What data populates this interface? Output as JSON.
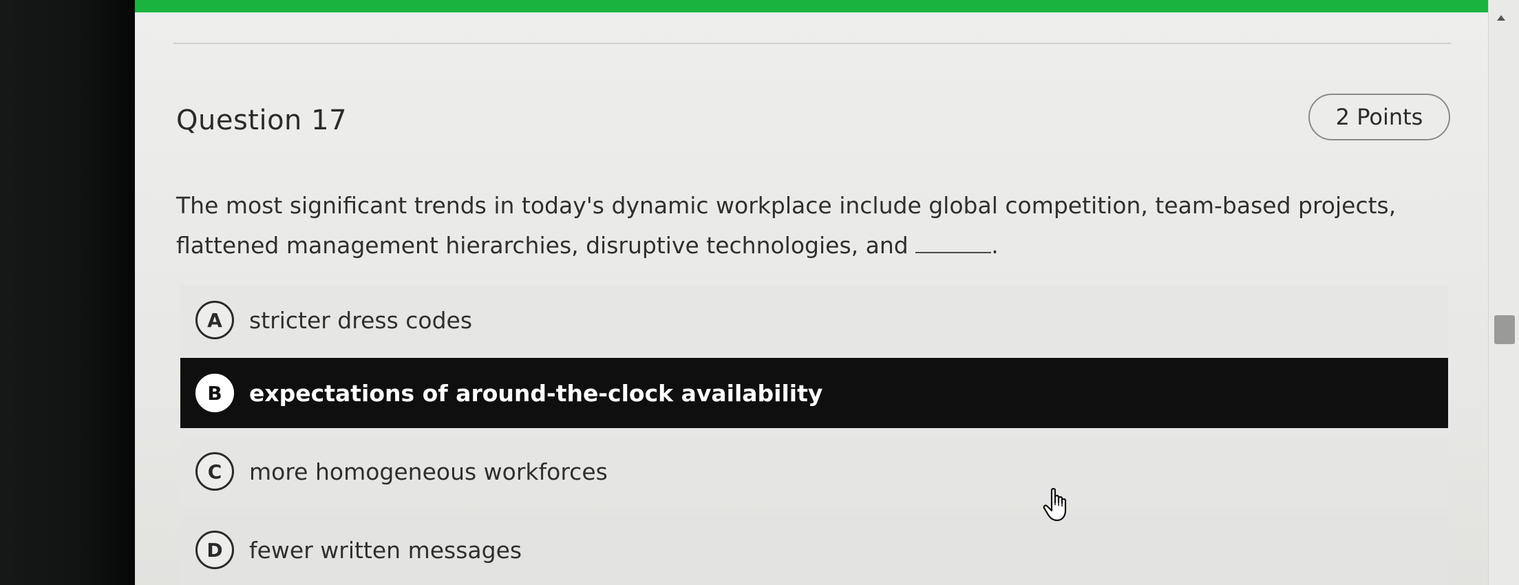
{
  "question": {
    "title": "Question 17",
    "points": "2 Points",
    "text_before": "The most significant trends in today's dynamic workplace include global competition, team-based projects, flattened management hierarchies, disruptive technologies, and",
    "text_after": "."
  },
  "options": [
    {
      "letter": "A",
      "text": "stricter dress codes",
      "selected": false
    },
    {
      "letter": "B",
      "text": "expectations of around-the-clock availability",
      "selected": true
    },
    {
      "letter": "C",
      "text": "more homogeneous workforces",
      "selected": false
    },
    {
      "letter": "D",
      "text": "fewer written messages",
      "selected": false
    }
  ],
  "colors": {
    "accent_bar": "#19b33e",
    "selected_bg": "#0f0f0f"
  },
  "icons": {
    "cursor": "hand-pointer-icon",
    "scroll": "chevron-up-icon"
  }
}
